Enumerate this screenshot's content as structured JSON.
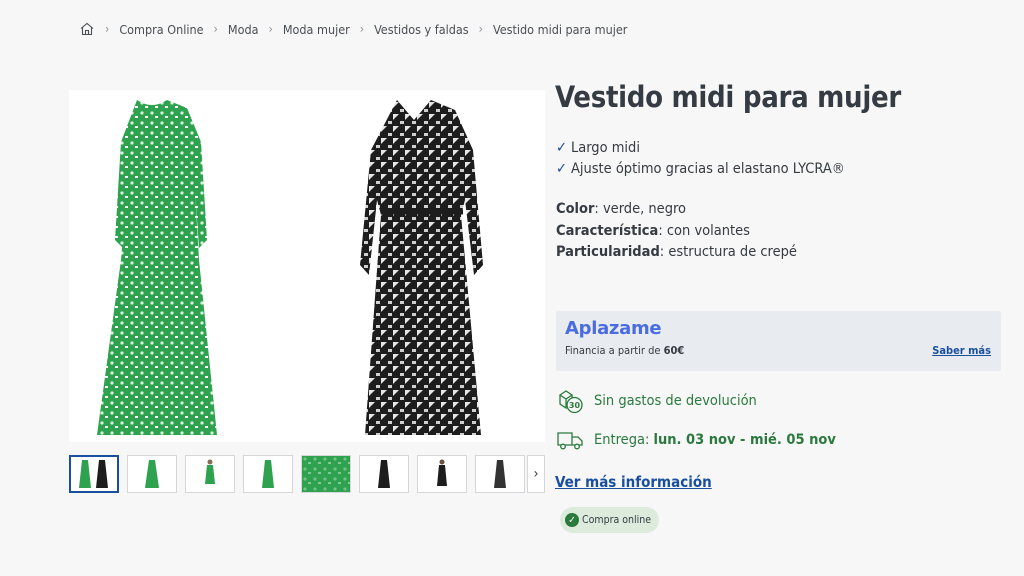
{
  "breadcrumb": {
    "home_icon": "home-icon",
    "items": [
      "Compra Online",
      "Moda",
      "Moda mujer",
      "Vestidos y faldas",
      "Vestido midi para mujer"
    ]
  },
  "product": {
    "title": "Vestido midi para mujer",
    "features": [
      "Largo midi",
      "Ajuste óptimo gracias al elastano LYCRA®"
    ],
    "specs": [
      {
        "label": "Color",
        "value": ": verde, negro"
      },
      {
        "label": "Característica",
        "value": ": con volantes"
      },
      {
        "label": "Particularidad",
        "value": ": estructura de crepé"
      }
    ]
  },
  "financing": {
    "brand": "Aplazame",
    "text_prefix": "Financia a partir de ",
    "amount": "60€",
    "link": "Saber más"
  },
  "returns": {
    "icon": "return-30-icon",
    "label": "Sin gastos de devolución"
  },
  "delivery": {
    "icon": "truck-icon",
    "prefix": "Entrega: ",
    "dates": "lun. 03 nov - mié. 05 nov"
  },
  "more_info": "Ver más información",
  "badge": {
    "icon": "check-circle-icon",
    "label": "Compra online"
  },
  "gallery": {
    "thumbnail_count": 8,
    "active_thumbnail": 1
  },
  "colors": {
    "title": "#353b42",
    "link": "#1a4fa0",
    "green": "#2a7a3d",
    "aplazame": "#4a6ce0",
    "dress_green": "#2fa24f",
    "dress_black": "#1d1d1d"
  }
}
